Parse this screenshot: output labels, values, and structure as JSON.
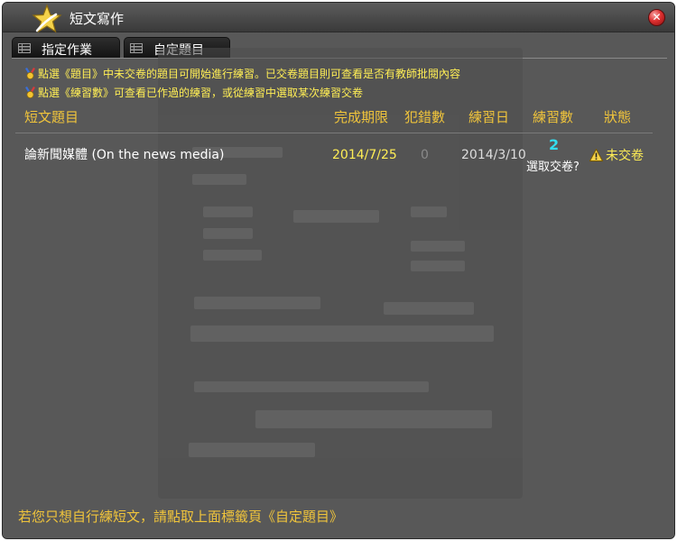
{
  "window": {
    "title": "短文寫作",
    "close_label": "✕"
  },
  "tabs": [
    {
      "label": "指定作業",
      "active": true
    },
    {
      "label": "自定題目",
      "active": false
    }
  ],
  "hints": [
    "點選《題目》中未交卷的題目可開始進行練習。已交卷題目則可查看是否有教師批閱內容",
    "點選《練習數》可查看已作過的練習，或從練習中選取某次練習交卷"
  ],
  "table": {
    "columns": [
      "短文題目",
      "完成期限",
      "犯錯數",
      "練習日",
      "練習數",
      "狀態"
    ],
    "rows": [
      {
        "topic": "論新聞媒體 (On the news media)",
        "deadline": "2014/7/25",
        "errors": "0",
        "practice_date": "2014/3/10",
        "practice_count": "2",
        "select_submit": "選取交卷?",
        "status": "未交卷"
      }
    ]
  },
  "footer": "若您只想自行練短文，請點取上面標籤頁《自定題目》",
  "colors": {
    "accent": "#f0c43b",
    "hint": "#ffee55",
    "count": "#33ddee",
    "panel": "#585858"
  }
}
